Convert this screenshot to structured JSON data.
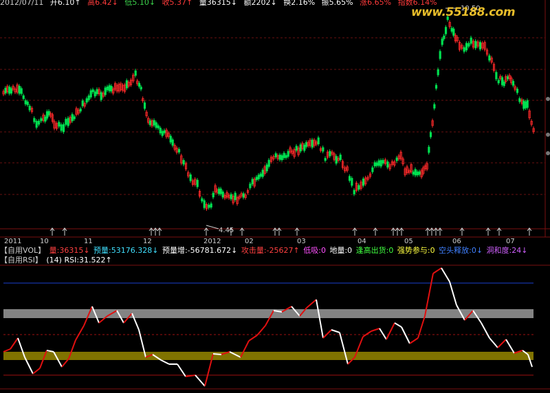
{
  "header": {
    "items": [
      {
        "text": "2012/07/11",
        "color": "#cfcfcf"
      },
      {
        "text": "开6.10↑",
        "color": "#ffffff"
      },
      {
        "text": "高6.42↓",
        "color": "#ff3b3b"
      },
      {
        "text": "低5.10↓",
        "color": "#3bd24b"
      },
      {
        "text": "收5.37↑",
        "color": "#ff3b3b"
      },
      {
        "text": "量36315↓",
        "color": "#ffffff"
      },
      {
        "text": "额2202↓",
        "color": "#ffffff"
      },
      {
        "text": "换2.16%",
        "color": "#ffffff"
      },
      {
        "text": "振5.65%",
        "color": "#ffffff"
      },
      {
        "text": "涨6.65%",
        "color": "#ff3b3b"
      },
      {
        "text": "指数6.14%",
        "color": "#ff3b3b"
      }
    ]
  },
  "watermark": "www.55188.com",
  "price_chart": {
    "high_label": "10.50",
    "low_label": "4.45",
    "colors": {
      "up": "#ff2a2a",
      "down": "#00e050",
      "grid": "#7a1010"
    }
  },
  "date_axis": {
    "labels": [
      "2011",
      "10",
      "11",
      "12",
      "2012",
      "02",
      "03",
      "04",
      "05",
      "06",
      "07"
    ]
  },
  "vol_legend": {
    "items": [
      {
        "text": "【自用VOL】",
        "color": "#cfcfcf"
      },
      {
        "text": "量:36315↓",
        "color": "#ff4040"
      },
      {
        "text": "预量:53176.328↓",
        "color": "#40e0ff"
      },
      {
        "text": "预量增:-56781.672↓",
        "color": "#ffffff"
      },
      {
        "text": "攻击量:-25627↑",
        "color": "#ff4040"
      },
      {
        "text": "低吸:0",
        "color": "#ff50ff"
      },
      {
        "text": "地量:0",
        "color": "#ffffff"
      },
      {
        "text": "逢高出货:0",
        "color": "#40ff40"
      },
      {
        "text": "强势参与:0",
        "color": "#ffff40"
      },
      {
        "text": "空头释放:0↓",
        "color": "#4080ff"
      },
      {
        "text": "洞和度:24↓",
        "color": "#d060ff"
      }
    ]
  },
  "rsi_legend": {
    "items": [
      {
        "text": "【自用RSI】",
        "color": "#cfcfcf"
      },
      {
        "text": "(14) RSI:31.522↑",
        "color": "#ffffff"
      }
    ]
  },
  "rsi_chart": {
    "colors": {
      "up": "#e01010",
      "down": "#ffffff",
      "upper_line": "#1a3fd0",
      "overbought_band": "#9a9a9a",
      "oversold_band": "#a09000"
    }
  }
}
